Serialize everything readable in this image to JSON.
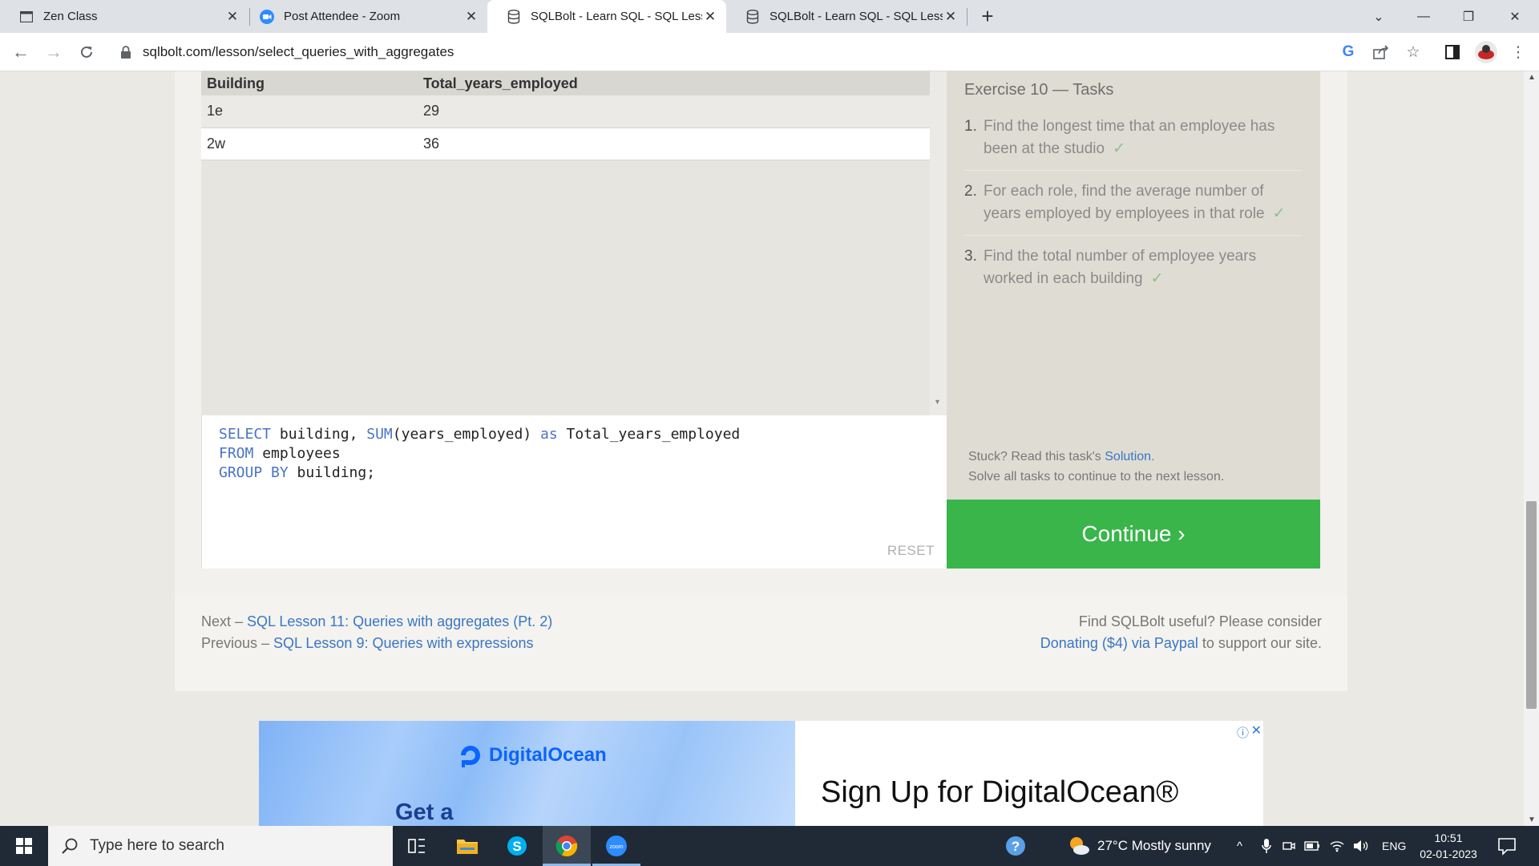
{
  "browser": {
    "tabs": [
      {
        "title": "Zen Class",
        "active": false
      },
      {
        "title": "Post Attendee - Zoom",
        "active": false
      },
      {
        "title": "SQLBolt - Learn SQL - SQL Lesson",
        "active": true
      },
      {
        "title": "SQLBolt - Learn SQL - SQL Lesson",
        "active": false
      }
    ],
    "url": "sqlbolt.com/lesson/select_queries_with_aggregates"
  },
  "results": {
    "columns": [
      "Building",
      "Total_years_employed"
    ],
    "rows": [
      [
        "1e",
        "29"
      ],
      [
        "2w",
        "36"
      ]
    ]
  },
  "editor": {
    "line1_kw": "SELECT",
    "line1_a": " building, ",
    "line1_fn": "SUM",
    "line1_b": "(years_employed) ",
    "line1_as": "as",
    "line1_c": " Total_years_employed",
    "line2_kw": "FROM",
    "line2_a": " employees",
    "line3_kw": "GROUP BY",
    "line3_a": " building;",
    "reset_label": "RESET"
  },
  "exercise": {
    "title": "Exercise 10 — Tasks",
    "tasks": [
      {
        "num": "1.",
        "line1": "Find the longest time that an employee has",
        "line2": "been at the studio",
        "check": "✓"
      },
      {
        "num": "2.",
        "line1": "For each role, find the average number of",
        "line2": "years employed by employees in that role",
        "check": "✓"
      },
      {
        "num": "3.",
        "line1": "Find the total number of employee years",
        "line2": "worked in each building",
        "check": "✓"
      }
    ],
    "stuck_prefix": "Stuck? Read this task's ",
    "solution_link": "Solution",
    "stuck_suffix": ".",
    "solve_all": "Solve all tasks to continue to the next lesson.",
    "continue_label": "Continue ›"
  },
  "lesson_nav": {
    "next_prefix": "Next – ",
    "next_link": "SQL Lesson 11: Queries with aggregates (Pt. 2)",
    "prev_prefix": "Previous – ",
    "prev_link": "SQL Lesson 9: Queries with expressions",
    "support_line1": "Find SQLBolt useful? Please consider",
    "donate_link": "Donating ($4) via Paypal",
    "support_suffix": " to support our site."
  },
  "ad": {
    "brand": "DigitalOcean",
    "teaser": "Get a",
    "headline": "Sign Up for DigitalOcean®"
  },
  "taskbar": {
    "search_placeholder": "Type here to search",
    "weather": "27°C  Mostly sunny",
    "lang": "ENG",
    "time": "10:51",
    "date": "02-01-2023"
  },
  "colors": {
    "continue": "#39b54a",
    "link": "#3a76c4",
    "keyword": "#4a73c7"
  }
}
